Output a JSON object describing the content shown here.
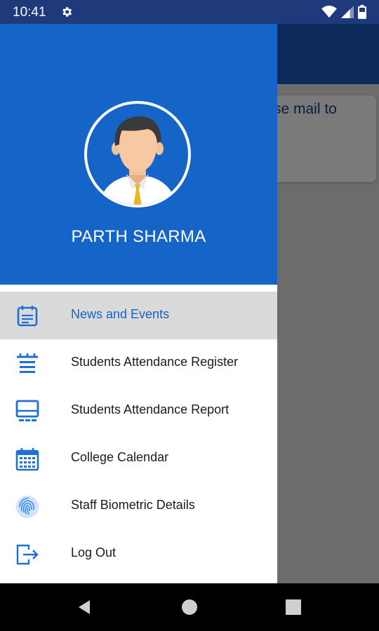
{
  "status_bar": {
    "time": "10:41",
    "icons": [
      "gear-icon",
      "wifi-icon",
      "signal-icon",
      "battery-icon"
    ]
  },
  "background_app": {
    "card_text": "se mail to"
  },
  "drawer": {
    "user_name": "PARTH SHARMA",
    "header_color": "#1565c8",
    "menu": [
      {
        "label": "News and Events",
        "icon": "news-calendar-icon",
        "selected": true
      },
      {
        "label": "Students Attendance Register",
        "icon": "register-list-icon",
        "selected": false
      },
      {
        "label": "Students Attendance Report",
        "icon": "report-monitor-icon",
        "selected": false
      },
      {
        "label": "College Calendar",
        "icon": "calendar-icon",
        "selected": false
      },
      {
        "label": "Staff Biometric Details",
        "icon": "fingerprint-icon",
        "selected": false
      },
      {
        "label": "Log Out",
        "icon": "logout-icon",
        "selected": false
      }
    ]
  },
  "nav_bar": {
    "buttons": [
      "back-icon",
      "home-icon",
      "recents-icon"
    ]
  },
  "colors": {
    "accent": "#1565c8",
    "icon_blue": "#1e6fd6",
    "selected_bg": "#dadada"
  }
}
